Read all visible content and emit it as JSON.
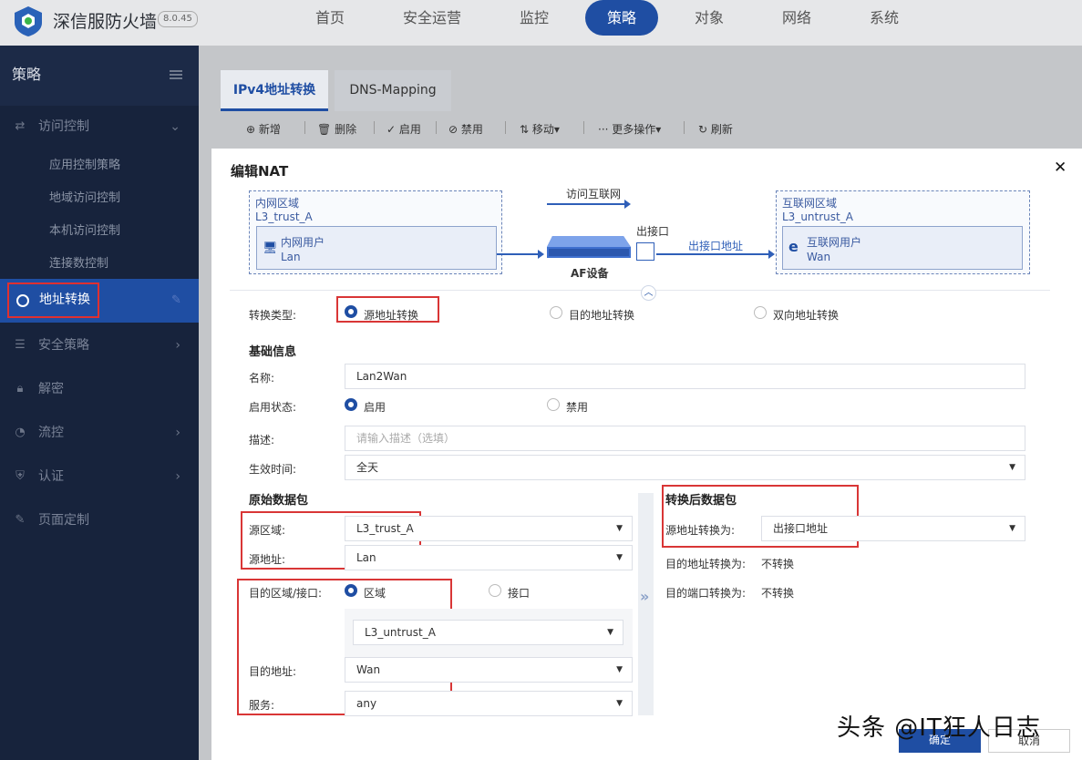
{
  "app": {
    "brand": "深信服防火墙",
    "version": "8.0.45"
  },
  "nav": [
    "首页",
    "安全运营",
    "监控",
    "策略",
    "对象",
    "网络",
    "系统"
  ],
  "nav_active": "策略",
  "sidebar": {
    "title": "策略",
    "groups": [
      {
        "label": "访问控制",
        "icon": "access-control-icon",
        "arrow": "⌄"
      },
      {
        "label": "地址转换",
        "icon": "globe-icon"
      },
      {
        "label": "安全策略",
        "icon": "list-icon",
        "arrow": "›"
      },
      {
        "label": "解密",
        "icon": "lock-icon"
      },
      {
        "label": "流控",
        "icon": "flow-icon",
        "arrow": "›"
      },
      {
        "label": "认证",
        "icon": "shield-icon",
        "arrow": "›"
      },
      {
        "label": "页面定制",
        "icon": "edit-icon"
      }
    ],
    "subitems": [
      "应用控制策略",
      "地域访问控制",
      "本机访问控制",
      "连接数控制"
    ]
  },
  "tabs": [
    "IPv4地址转换",
    "DNS-Mapping"
  ],
  "toolbar": [
    "新增",
    "删除",
    "启用",
    "禁用",
    "移动",
    "更多操作",
    "刷新"
  ],
  "modal": {
    "title": "编辑NAT",
    "diagram": {
      "inner_zone": "内网区域",
      "inner_zone_name": "L3_trust_A",
      "inner_user": "内网用户",
      "inner_iface": "Lan",
      "flow_label": "访问互联网",
      "device": "AF设备",
      "out_iface": "出接口",
      "out_addr": "出接口地址",
      "outer_zone": "互联网区域",
      "outer_zone_name": "L3_untrust_A",
      "outer_user": "互联网用户",
      "outer_iface": "Wan"
    },
    "conv_type_label": "转换类型:",
    "conv_types": [
      "源地址转换",
      "目的地址转换",
      "双向地址转换"
    ],
    "basic_title": "基础信息",
    "name_label": "名称:",
    "name_value": "Lan2Wan",
    "status_label": "启用状态:",
    "status_on": "启用",
    "status_off": "禁用",
    "desc_label": "描述:",
    "desc_placeholder": "请输入描述（选填）",
    "time_label": "生效时间:",
    "time_value": "全天",
    "orig_title": "原始数据包",
    "src_zone_label": "源区域:",
    "src_zone_value": "L3_trust_A",
    "src_addr_label": "源地址:",
    "src_addr_value": "Lan",
    "dst_zone_label": "目的区域/接口:",
    "dst_opt_zone": "区域",
    "dst_opt_iface": "接口",
    "dst_zone_value": "L3_untrust_A",
    "dst_addr_label": "目的地址:",
    "dst_addr_value": "Wan",
    "service_label": "服务:",
    "service_value": "any",
    "after_title": "转换后数据包",
    "src_conv_label": "源地址转换为:",
    "src_conv_value": "出接口地址",
    "dst_conv_label": "目的地址转换为:",
    "dst_conv_value": "不转换",
    "port_conv_label": "目的端口转换为:",
    "port_conv_value": "不转换",
    "ok": "确定",
    "cancel": "取消"
  },
  "watermark": "头条 @IT狂人日志",
  "colors": {
    "accent": "#1f4ea3",
    "highlight": "#d93636",
    "sidebar": "#17233c"
  }
}
